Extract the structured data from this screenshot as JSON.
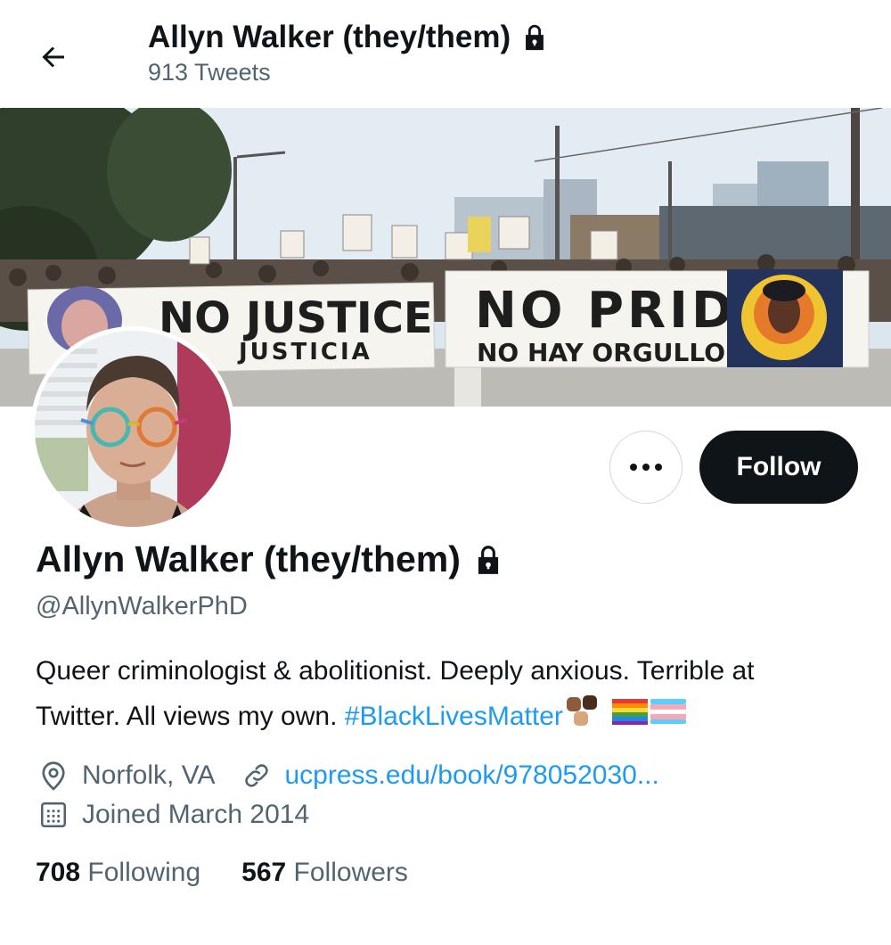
{
  "header": {
    "title": "Allyn Walker (they/them)",
    "tweet_count": "913 Tweets"
  },
  "banner": {
    "sign_left_line1": "NO JUSTICE",
    "sign_left_line2": "JUSTICIA",
    "sign_right_line1": "NO PRIDE",
    "sign_right_line2": "NO HAY ORGULLO"
  },
  "actions": {
    "follow_label": "Follow"
  },
  "profile": {
    "name": "Allyn Walker (they/them)",
    "handle": "@AllynWalkerPhD",
    "bio_text_line1": "Queer criminologist & abolitionist. Deeply anxious. Terrible at",
    "bio_text_line2": "Twitter. All views my own.",
    "bio_hashtag": "#BlackLivesMatter",
    "location": "Norfolk, VA",
    "website": "ucpress.edu/book/978052030...",
    "joined": "Joined March 2014"
  },
  "stats": {
    "following_count": "708",
    "following_label": "Following",
    "followers_count": "567",
    "followers_label": "Followers"
  },
  "icons": {
    "back": "arrow-left-icon",
    "lock": "lock-icon",
    "more": "more-icon",
    "location": "location-pin-icon",
    "link": "link-icon",
    "calendar": "calendar-icon"
  },
  "colors": {
    "accent": "#1d9bf0",
    "text": "#0f1419",
    "secondary": "#536471",
    "follow_bg": "#0f1419"
  }
}
